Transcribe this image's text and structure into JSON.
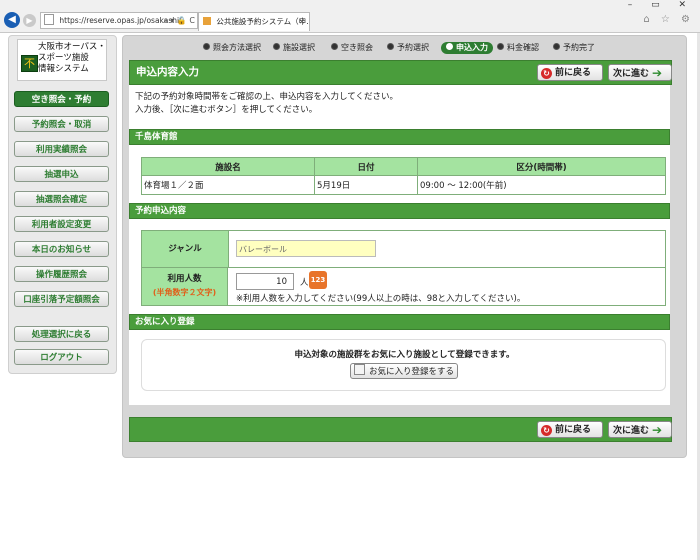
{
  "browser": {
    "window_controls": "– ▭ ✕",
    "url": "https://reserve.opas.jp/osakashi/",
    "addr_icons": "⌕ ▾ 🔒 C",
    "tab_title": "公共施設予約システム（申…",
    "tab_close": "✕",
    "toolbar_icons": "⌂ ☆ ⚙"
  },
  "logo": {
    "mark": "不",
    "line1": "大阪市オーパス・",
    "line2": "スポーツ施設",
    "line3": "情報システム"
  },
  "sidebar": {
    "items": [
      {
        "label": "空き照会・予約"
      },
      {
        "label": "予約照会・取消"
      },
      {
        "label": "利用実績照会"
      },
      {
        "label": "抽選申込"
      },
      {
        "label": "抽選照会確定"
      },
      {
        "label": "利用者設定変更"
      },
      {
        "label": "本日のお知らせ"
      },
      {
        "label": "操作履歴照会"
      },
      {
        "label": "口座引落予定額照会"
      },
      {
        "label": "処理選択に戻る"
      },
      {
        "label": "ログアウト"
      }
    ]
  },
  "steps": [
    {
      "label": "照会方法選択"
    },
    {
      "label": "施設選択"
    },
    {
      "label": "空き照会"
    },
    {
      "label": "予約選択"
    },
    {
      "label": "申込入力"
    },
    {
      "label": "料金確認"
    },
    {
      "label": "予約完了"
    }
  ],
  "header": {
    "title": "申込内容入力",
    "back_label": "前に戻る",
    "next_label": "次に進む",
    "back_icon": "↻",
    "next_icon": "➔"
  },
  "intro": {
    "line1": "下記の予約対象時間帯をご確認の上、申込内容を入力してください。",
    "line2": "入力後、［次に進むボタン］を押してください。"
  },
  "facility": {
    "section_title": "千島体育館",
    "columns": [
      "施設名",
      "日付",
      "区分(時間帯)"
    ],
    "row": {
      "name": "体育場１／２面",
      "date": "5月19日",
      "slot": "09:00 ～ 12:00(午前)"
    }
  },
  "application": {
    "section_title": "予約申込内容",
    "genre_label": "ジャンル",
    "genre_value": "バレーボール",
    "count_label": "利用人数",
    "count_sublabel": "(半角数字２文字)",
    "count_value": "10",
    "count_unit": "人",
    "calc_icon": "123",
    "count_note": "※利用人数を入力してください(99人以上の時は、98と入力してください)。"
  },
  "favorites": {
    "section_title": "お気に入り登録",
    "description": "申込対象の施設群をお気に入り施設として登録できます。",
    "button_label": "お気に入り登録をする"
  },
  "colors": {
    "accent_green": "#4a9d3c",
    "header_green": "#a4e3a0",
    "input_yellow": "#ffffc0"
  }
}
